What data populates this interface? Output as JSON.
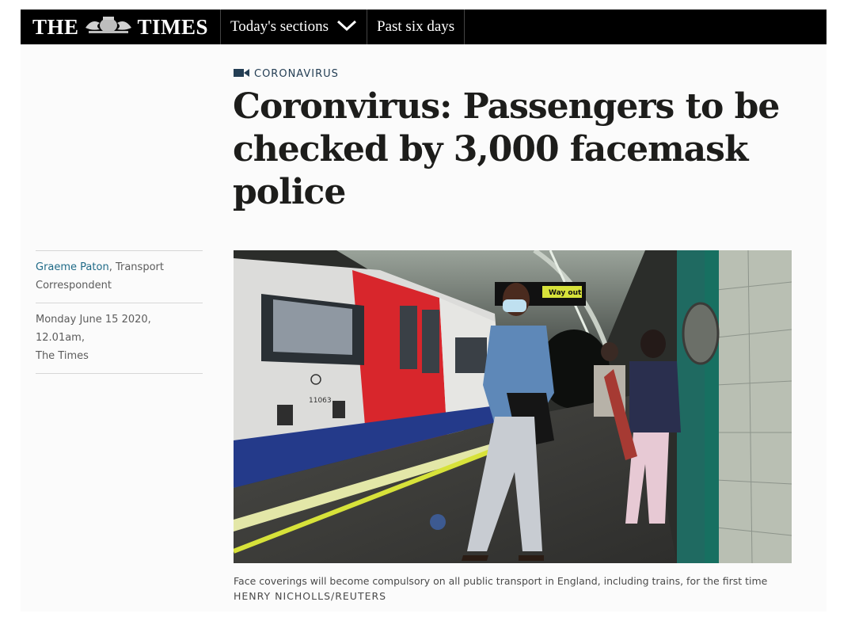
{
  "masthead": {
    "logo_left": "THE",
    "logo_right": "TIMES",
    "crest_icon": "royal-crest-icon"
  },
  "nav": {
    "sections_label": "Today's sections",
    "past_label": "Past six days"
  },
  "article": {
    "section_label": "CORONAVIRUS",
    "headline": "Coronvirus: Passengers to be checked by 3,000 facemask police",
    "author": "Graeme Paton",
    "author_role": ", Transport Correspondent",
    "date": "Monday June 15 2020, 12.01am,",
    "publication": "The Times",
    "photo_caption": "Face coverings will become compulsory on all public transport in England, including trains, for the first time",
    "photo_credit": "HENRY NICHOLLS/REUTERS",
    "train_number": "11063",
    "sign_text": "Way out"
  },
  "colors": {
    "accent": "#1f6a87",
    "section": "#243e54",
    "topbar": "#000000"
  }
}
